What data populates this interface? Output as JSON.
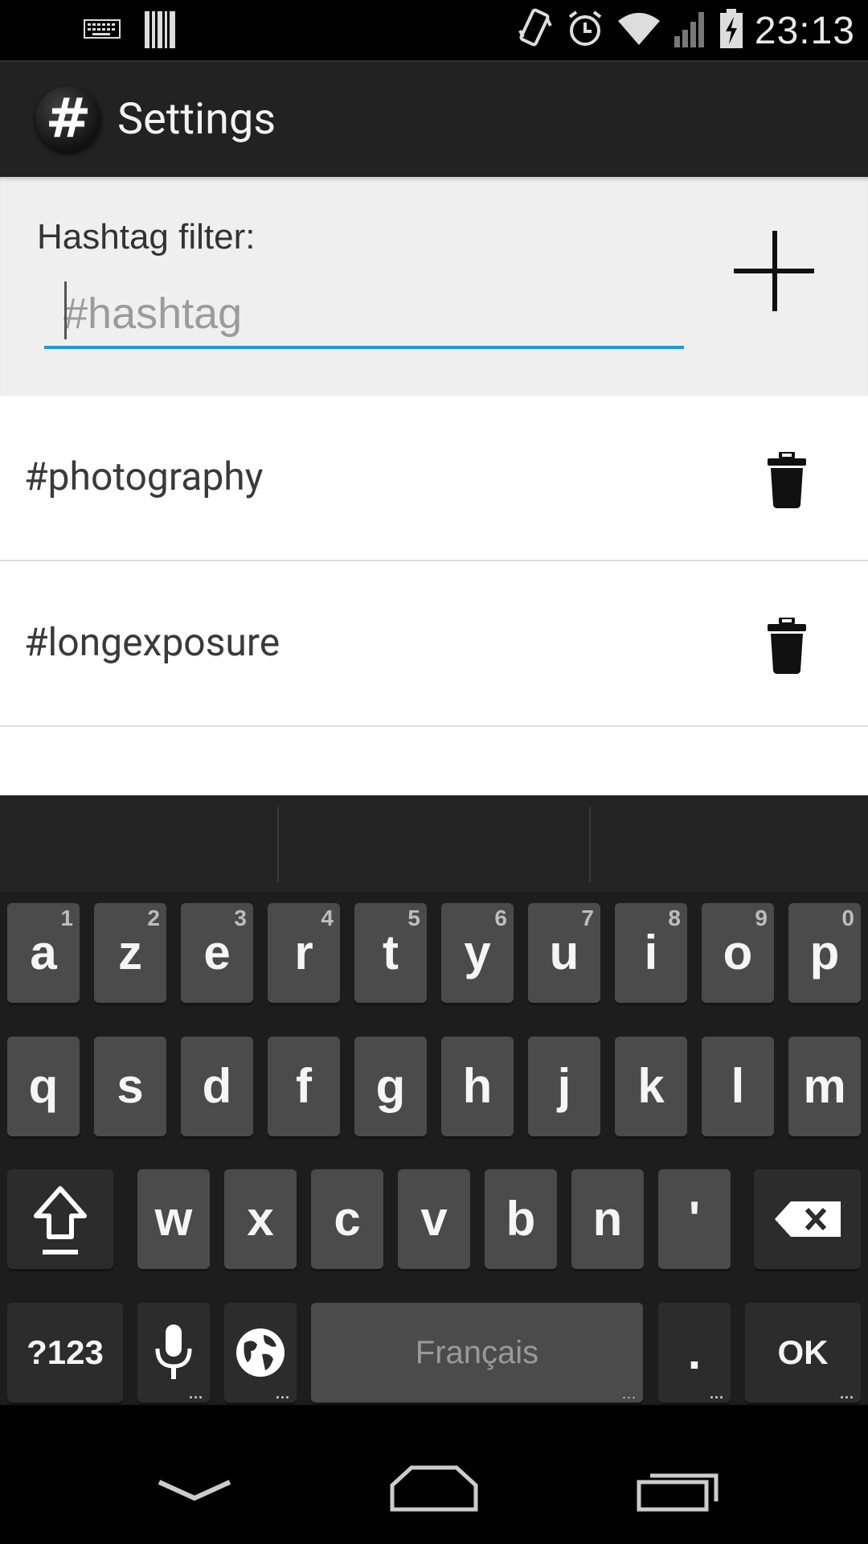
{
  "status_bar": {
    "time": "23:13",
    "icons": [
      "keyboard-icon",
      "barcode-icon",
      "vibrate-icon",
      "alarm-icon",
      "wifi-icon",
      "cell-signal-icon",
      "battery-charging-icon"
    ]
  },
  "action_bar": {
    "icon_glyph": "#",
    "title": "Settings"
  },
  "filter": {
    "label": "Hashtag filter:",
    "value": "",
    "placeholder": "#hashtag",
    "add_icon": "plus-icon"
  },
  "hashtags": [
    {
      "tag": "#photography",
      "action_icon": "trash-icon"
    },
    {
      "tag": "#longexposure",
      "action_icon": "trash-icon"
    }
  ],
  "keyboard": {
    "row1": [
      {
        "label": "a",
        "hint": "1"
      },
      {
        "label": "z",
        "hint": "2"
      },
      {
        "label": "e",
        "hint": "3"
      },
      {
        "label": "r",
        "hint": "4"
      },
      {
        "label": "t",
        "hint": "5"
      },
      {
        "label": "y",
        "hint": "6"
      },
      {
        "label": "u",
        "hint": "7"
      },
      {
        "label": "i",
        "hint": "8"
      },
      {
        "label": "o",
        "hint": "9"
      },
      {
        "label": "p",
        "hint": "0"
      }
    ],
    "row2": [
      "q",
      "s",
      "d",
      "f",
      "g",
      "h",
      "j",
      "k",
      "l",
      "m"
    ],
    "row3": [
      "w",
      "x",
      "c",
      "v",
      "b",
      "n",
      "'"
    ],
    "symbols_label": "?123",
    "space_label": "Français",
    "period_label": ".",
    "enter_label": "OK",
    "more_hint": "...",
    "accent_color": "#1e9bd7"
  },
  "nav_bar": {
    "icons": [
      "back-down-icon",
      "home-icon",
      "recent-apps-icon"
    ]
  }
}
